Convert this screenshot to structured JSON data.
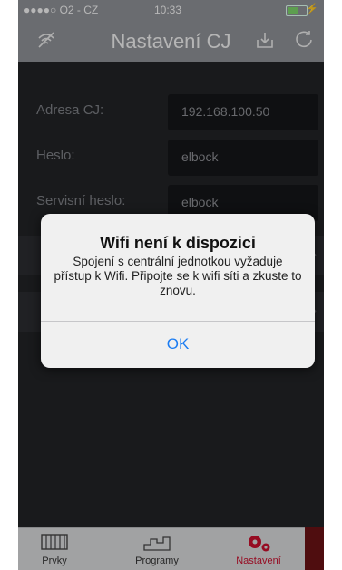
{
  "status": {
    "carrier": "●●●●○ O2 - CZ",
    "time": "10:33"
  },
  "navbar": {
    "title": "Nastavení CJ"
  },
  "rows": [
    {
      "label": "Adresa CJ:",
      "value": "192.168.100.50"
    },
    {
      "label": "Heslo:",
      "value": "elbock"
    },
    {
      "label": "Servisní heslo:",
      "value": "elbock"
    }
  ],
  "alert": {
    "title": "Wifi není k dispozici",
    "message": "Spojení s centrální jednotkou vyžaduje přístup k Wifi. Připojte se k wifi síti a zkuste to znovu.",
    "ok": "OK"
  },
  "tabs": [
    {
      "label": "Prvky",
      "icon": "radiator-icon"
    },
    {
      "label": "Programy",
      "icon": "program-icon"
    },
    {
      "label": "Nastavení",
      "icon": "gears-icon"
    }
  ],
  "colors": {
    "accent": "#c8102e",
    "ok_blue": "#1b7cf2"
  }
}
